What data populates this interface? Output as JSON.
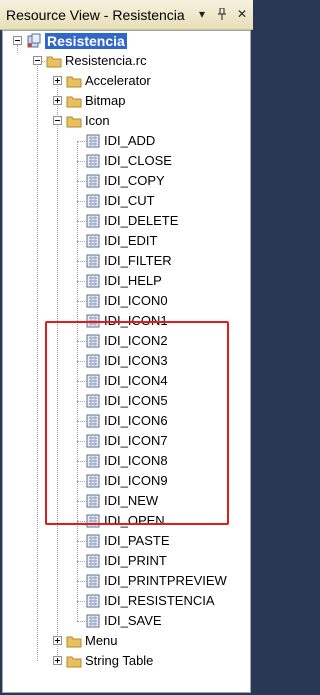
{
  "window": {
    "title": "Resource View - Resistencia",
    "buttons": [
      "dropdown-icon",
      "pin-icon",
      "close-icon"
    ]
  },
  "tree": {
    "root": {
      "label": "Resistencia",
      "selected": true
    },
    "file": {
      "label": "Resistencia.rc"
    },
    "folders": [
      {
        "label": "Accelerator",
        "expanded": false
      },
      {
        "label": "Bitmap",
        "expanded": false
      },
      {
        "label": "Icon",
        "expanded": true
      },
      {
        "label": "Menu",
        "expanded": false
      },
      {
        "label": "String Table",
        "expanded": false
      }
    ],
    "icons": [
      "IDI_ADD",
      "IDI_CLOSE",
      "IDI_COPY",
      "IDI_CUT",
      "IDI_DELETE",
      "IDI_EDIT",
      "IDI_FILTER",
      "IDI_HELP",
      "IDI_ICON0",
      "IDI_ICON1",
      "IDI_ICON2",
      "IDI_ICON3",
      "IDI_ICON4",
      "IDI_ICON5",
      "IDI_ICON6",
      "IDI_ICON7",
      "IDI_ICON8",
      "IDI_ICON9",
      "IDI_NEW",
      "IDI_OPEN",
      "IDI_PASTE",
      "IDI_PRINT",
      "IDI_PRINTPREVIEW",
      "IDI_RESISTENCIA",
      "IDI_SAVE"
    ]
  },
  "colors": {
    "highlight": "#e21b1b",
    "selection": "#3067c9",
    "folder": "#e8c060"
  }
}
